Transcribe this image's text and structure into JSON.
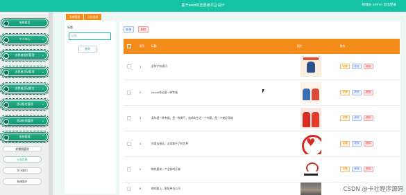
{
  "header": {
    "title": "基于web的志愿者平台设计",
    "user": "管理员 admin  退出登录"
  },
  "sidebar": {
    "items": [
      {
        "label": "系统首页",
        "expandable": false
      },
      {
        "label": "个人中心",
        "expandable": true
      },
      {
        "label": "志愿者组织管理",
        "expandable": true
      },
      {
        "label": "志愿者活动管理",
        "expandable": true
      },
      {
        "label": "志愿者活动报名",
        "expandable": true
      },
      {
        "label": "活动报名管理",
        "expandable": true
      },
      {
        "label": "活动时间管理",
        "expandable": true
      },
      {
        "label": "系统管理",
        "expandable": true
      }
    ],
    "subitems": [
      {
        "label": "轮播图管理",
        "active": false
      },
      {
        "label": "公告信息",
        "active": true
      },
      {
        "label": "关于我们",
        "active": false
      },
      {
        "label": "系统简介",
        "active": false
      }
    ]
  },
  "breadcrumb": [
    "系统管理",
    "公告信息"
  ],
  "search": {
    "label": "标题",
    "placeholder": "标题",
    "button": "查询"
  },
  "toolbar": {
    "add": "新增",
    "delete": "删除"
  },
  "table": {
    "columns": {
      "index": "索引",
      "title": "标题",
      "image": "图片",
      "actions": "操作"
    },
    "rows": [
      {
        "index": "1",
        "title": "坚持才有成功",
        "image": "volunteer-poster-1"
      },
      {
        "index": "2",
        "title": "Leave作必要一种幸福",
        "image": "volunteer-poster-2"
      },
      {
        "index": "3",
        "title": "青年是一种幸福，是一种勇气，追求和生活一个专题，是一个美好开端",
        "image": "volunteers-in-red-vests"
      },
      {
        "index": "4",
        "title": "你要去很远，这条路不了的世界",
        "image": "heart-logo"
      },
      {
        "index": "5",
        "title": "做的要来一个全新的开端",
        "image": "volunteer-logo-badge"
      },
      {
        "index": "6",
        "title": "做的要上，困境单位公司",
        "image": "group-photo"
      }
    ],
    "action_labels": {
      "detail": "详情",
      "edit": "修改",
      "delete": "删除"
    }
  },
  "watermark": "CSDN @卡社程序源码",
  "colors": {
    "primary": "#14c4a4",
    "accent": "#f28b1a",
    "sidebar": "#eef0ef"
  }
}
